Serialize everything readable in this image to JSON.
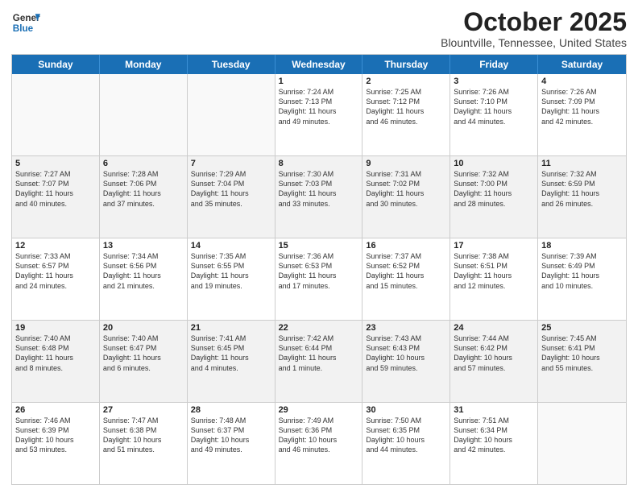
{
  "logo": {
    "line1": "General",
    "line2": "Blue"
  },
  "header": {
    "month": "October 2025",
    "location": "Blountville, Tennessee, United States"
  },
  "weekdays": [
    "Sunday",
    "Monday",
    "Tuesday",
    "Wednesday",
    "Thursday",
    "Friday",
    "Saturday"
  ],
  "rows": [
    [
      {
        "day": "",
        "text": ""
      },
      {
        "day": "",
        "text": ""
      },
      {
        "day": "",
        "text": ""
      },
      {
        "day": "1",
        "text": "Sunrise: 7:24 AM\nSunset: 7:13 PM\nDaylight: 11 hours\nand 49 minutes."
      },
      {
        "day": "2",
        "text": "Sunrise: 7:25 AM\nSunset: 7:12 PM\nDaylight: 11 hours\nand 46 minutes."
      },
      {
        "day": "3",
        "text": "Sunrise: 7:26 AM\nSunset: 7:10 PM\nDaylight: 11 hours\nand 44 minutes."
      },
      {
        "day": "4",
        "text": "Sunrise: 7:26 AM\nSunset: 7:09 PM\nDaylight: 11 hours\nand 42 minutes."
      }
    ],
    [
      {
        "day": "5",
        "text": "Sunrise: 7:27 AM\nSunset: 7:07 PM\nDaylight: 11 hours\nand 40 minutes."
      },
      {
        "day": "6",
        "text": "Sunrise: 7:28 AM\nSunset: 7:06 PM\nDaylight: 11 hours\nand 37 minutes."
      },
      {
        "day": "7",
        "text": "Sunrise: 7:29 AM\nSunset: 7:04 PM\nDaylight: 11 hours\nand 35 minutes."
      },
      {
        "day": "8",
        "text": "Sunrise: 7:30 AM\nSunset: 7:03 PM\nDaylight: 11 hours\nand 33 minutes."
      },
      {
        "day": "9",
        "text": "Sunrise: 7:31 AM\nSunset: 7:02 PM\nDaylight: 11 hours\nand 30 minutes."
      },
      {
        "day": "10",
        "text": "Sunrise: 7:32 AM\nSunset: 7:00 PM\nDaylight: 11 hours\nand 28 minutes."
      },
      {
        "day": "11",
        "text": "Sunrise: 7:32 AM\nSunset: 6:59 PM\nDaylight: 11 hours\nand 26 minutes."
      }
    ],
    [
      {
        "day": "12",
        "text": "Sunrise: 7:33 AM\nSunset: 6:57 PM\nDaylight: 11 hours\nand 24 minutes."
      },
      {
        "day": "13",
        "text": "Sunrise: 7:34 AM\nSunset: 6:56 PM\nDaylight: 11 hours\nand 21 minutes."
      },
      {
        "day": "14",
        "text": "Sunrise: 7:35 AM\nSunset: 6:55 PM\nDaylight: 11 hours\nand 19 minutes."
      },
      {
        "day": "15",
        "text": "Sunrise: 7:36 AM\nSunset: 6:53 PM\nDaylight: 11 hours\nand 17 minutes."
      },
      {
        "day": "16",
        "text": "Sunrise: 7:37 AM\nSunset: 6:52 PM\nDaylight: 11 hours\nand 15 minutes."
      },
      {
        "day": "17",
        "text": "Sunrise: 7:38 AM\nSunset: 6:51 PM\nDaylight: 11 hours\nand 12 minutes."
      },
      {
        "day": "18",
        "text": "Sunrise: 7:39 AM\nSunset: 6:49 PM\nDaylight: 11 hours\nand 10 minutes."
      }
    ],
    [
      {
        "day": "19",
        "text": "Sunrise: 7:40 AM\nSunset: 6:48 PM\nDaylight: 11 hours\nand 8 minutes."
      },
      {
        "day": "20",
        "text": "Sunrise: 7:40 AM\nSunset: 6:47 PM\nDaylight: 11 hours\nand 6 minutes."
      },
      {
        "day": "21",
        "text": "Sunrise: 7:41 AM\nSunset: 6:45 PM\nDaylight: 11 hours\nand 4 minutes."
      },
      {
        "day": "22",
        "text": "Sunrise: 7:42 AM\nSunset: 6:44 PM\nDaylight: 11 hours\nand 1 minute."
      },
      {
        "day": "23",
        "text": "Sunrise: 7:43 AM\nSunset: 6:43 PM\nDaylight: 10 hours\nand 59 minutes."
      },
      {
        "day": "24",
        "text": "Sunrise: 7:44 AM\nSunset: 6:42 PM\nDaylight: 10 hours\nand 57 minutes."
      },
      {
        "day": "25",
        "text": "Sunrise: 7:45 AM\nSunset: 6:41 PM\nDaylight: 10 hours\nand 55 minutes."
      }
    ],
    [
      {
        "day": "26",
        "text": "Sunrise: 7:46 AM\nSunset: 6:39 PM\nDaylight: 10 hours\nand 53 minutes."
      },
      {
        "day": "27",
        "text": "Sunrise: 7:47 AM\nSunset: 6:38 PM\nDaylight: 10 hours\nand 51 minutes."
      },
      {
        "day": "28",
        "text": "Sunrise: 7:48 AM\nSunset: 6:37 PM\nDaylight: 10 hours\nand 49 minutes."
      },
      {
        "day": "29",
        "text": "Sunrise: 7:49 AM\nSunset: 6:36 PM\nDaylight: 10 hours\nand 46 minutes."
      },
      {
        "day": "30",
        "text": "Sunrise: 7:50 AM\nSunset: 6:35 PM\nDaylight: 10 hours\nand 44 minutes."
      },
      {
        "day": "31",
        "text": "Sunrise: 7:51 AM\nSunset: 6:34 PM\nDaylight: 10 hours\nand 42 minutes."
      },
      {
        "day": "",
        "text": ""
      }
    ]
  ]
}
